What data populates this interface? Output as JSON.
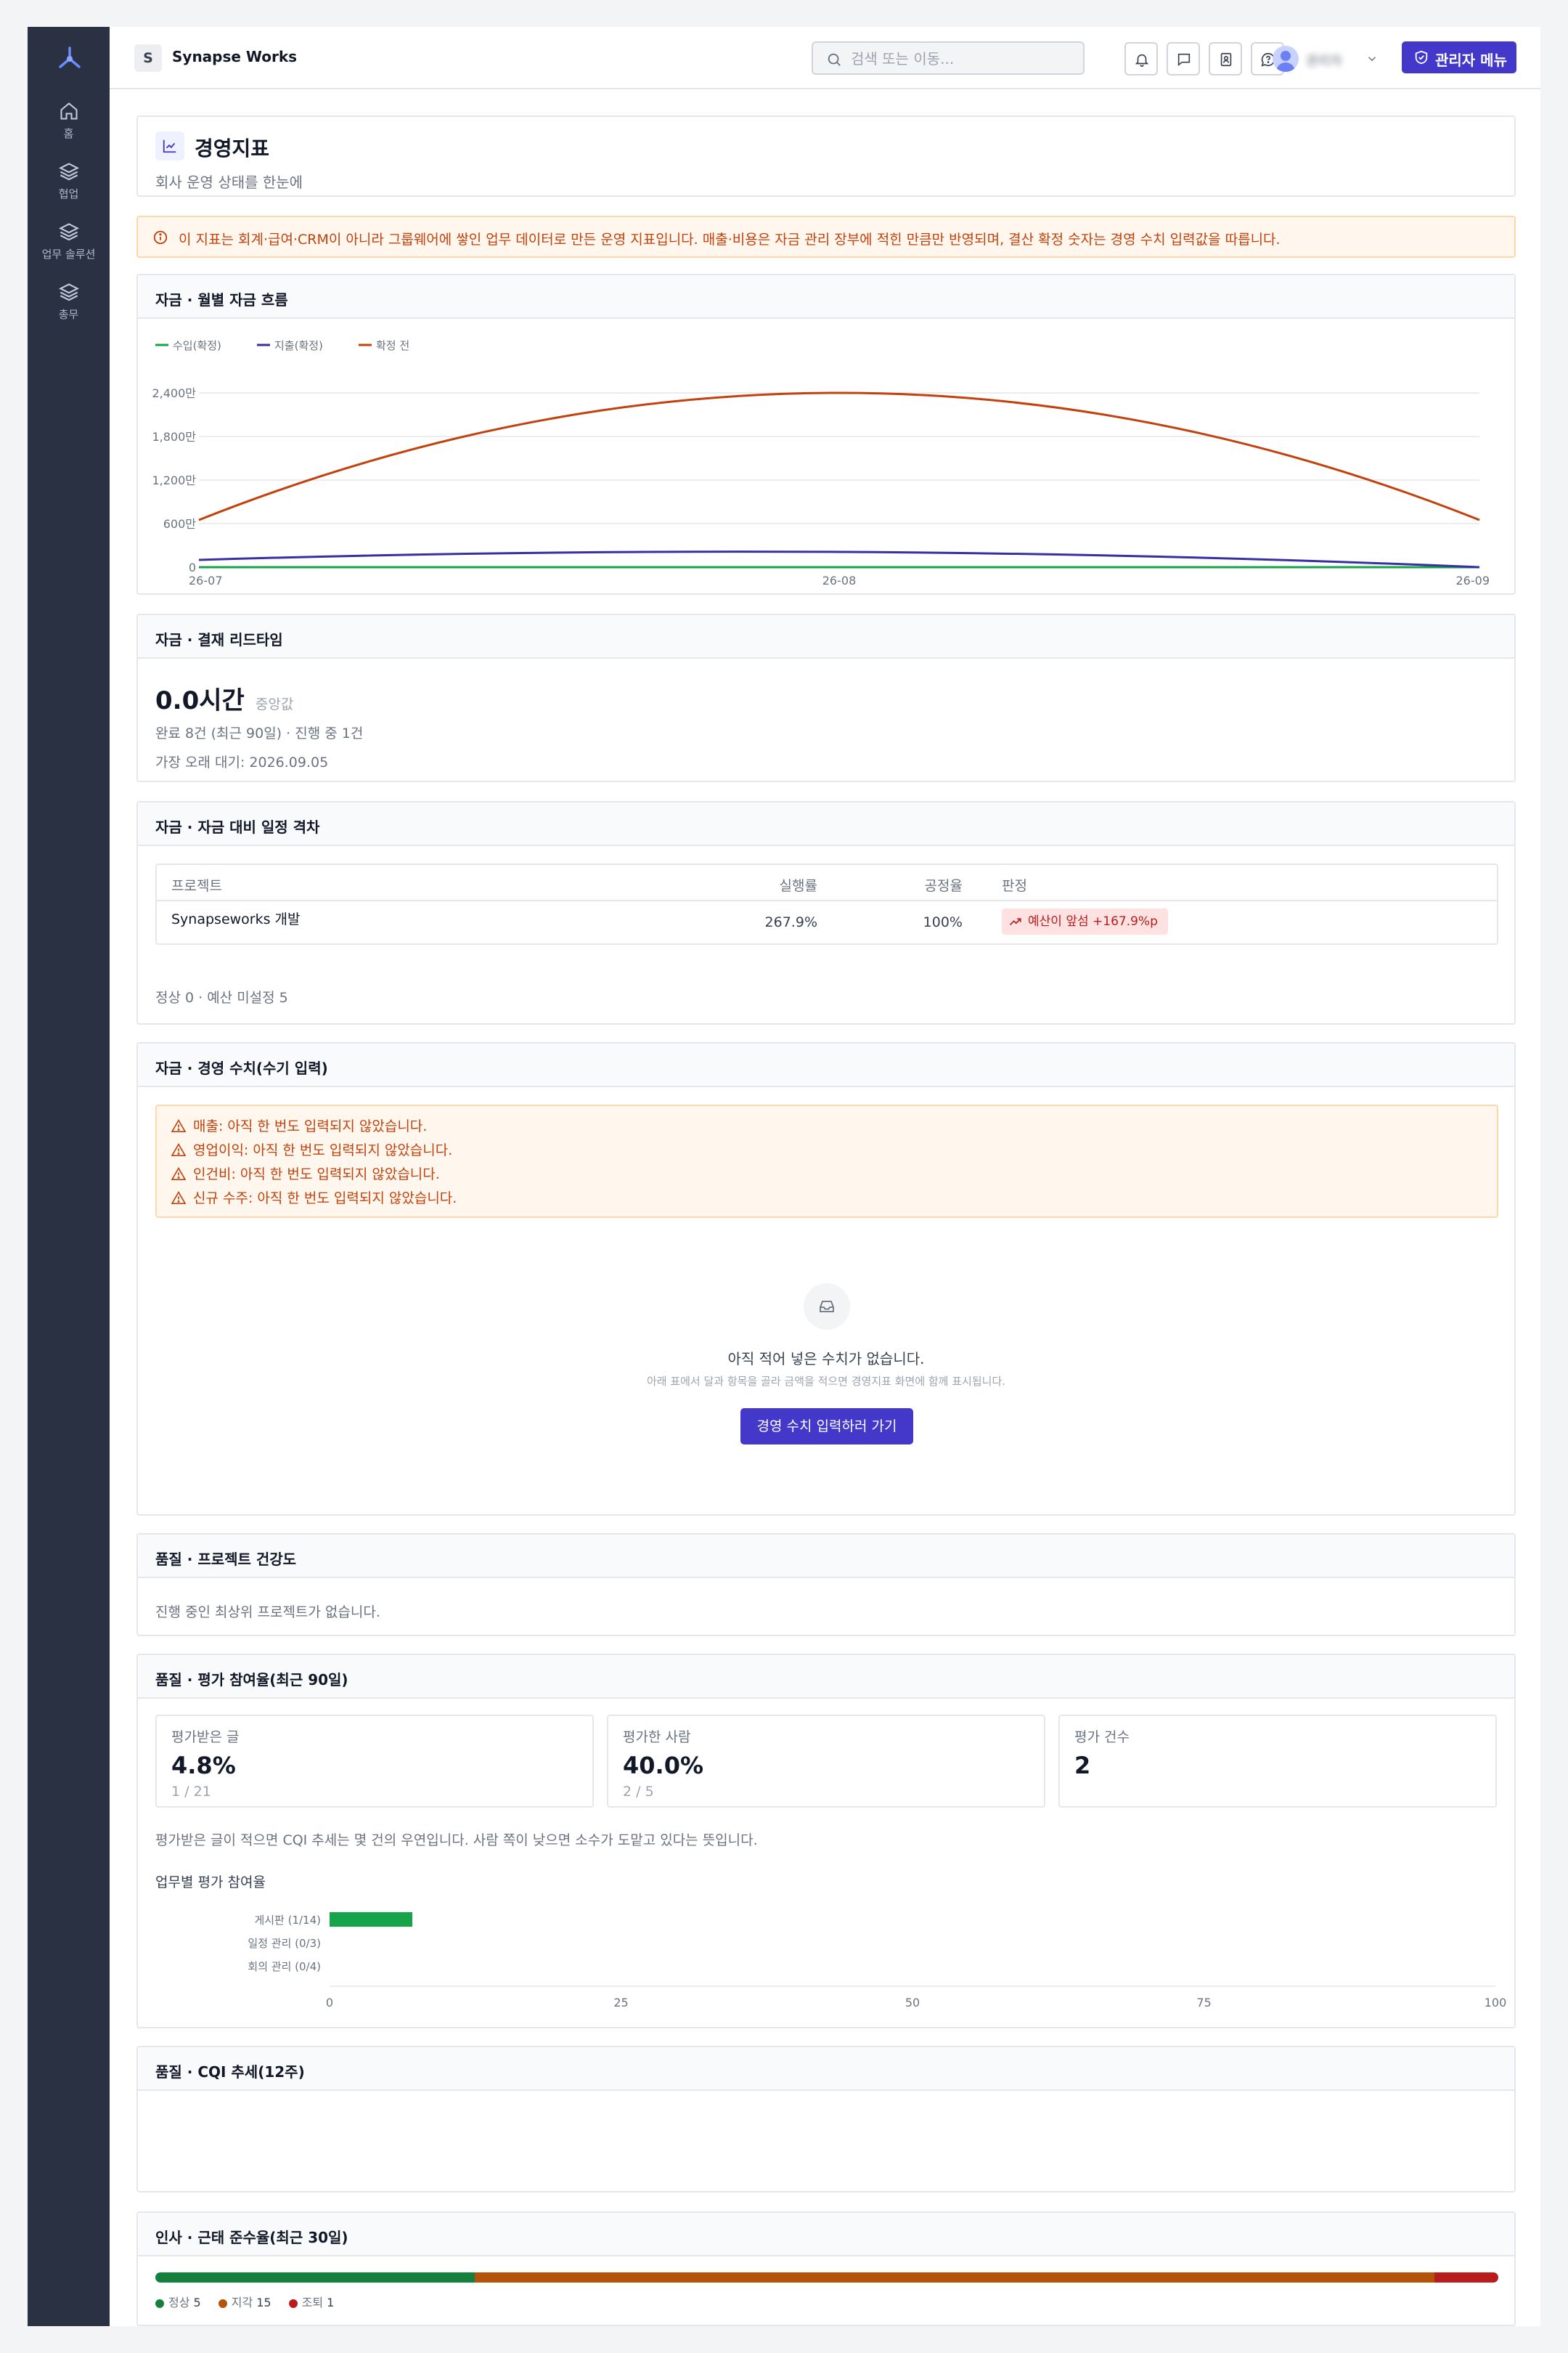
{
  "app": {
    "workspace_badge": "S",
    "workspace_name": "Synapse Works"
  },
  "sidebar": {
    "items": [
      {
        "label": "홈",
        "icon": "home-icon"
      },
      {
        "label": "협업",
        "icon": "layers-icon"
      },
      {
        "label": "업무 솔루션",
        "icon": "layers-icon"
      },
      {
        "label": "총무",
        "icon": "layers-icon"
      }
    ]
  },
  "topbar": {
    "search_placeholder": "검색 또는 이동...",
    "user_name": "관리자",
    "admin_button": "관리자 메뉴"
  },
  "page": {
    "title": "경영지표",
    "subtitle": "회사 운영 상태를 한눈에"
  },
  "notice": "이 지표는 회계·급여·CRM이 아니라 그룹웨어에 쌓인 업무 데이터로 만든 운영 지표입니다. 매출·비용은 자금 관리 장부에 적힌 만큼만 반영되며, 결산 확정 숫자는 경영 수치 입력값을 따릅니다.",
  "cashflow": {
    "title": "자금 · 월별 자금 흐름",
    "colors": {
      "income": "#16a34a",
      "expense": "#3730a3",
      "pending": "#c2410c"
    }
  },
  "chart_data": {
    "type": "line",
    "x": [
      "26-07",
      "26-08",
      "26-09"
    ],
    "series": [
      {
        "name": "수입(확정)",
        "values": [
          0,
          0,
          0
        ]
      },
      {
        "name": "지출(확정)",
        "values": [
          100,
          210,
          0
        ]
      },
      {
        "name": "확정 전",
        "values": [
          650,
          2400,
          650
        ]
      }
    ],
    "yticks": [
      "0",
      "600만",
      "1,200만",
      "1,800만",
      "2,400만"
    ],
    "ylim": [
      0,
      2400
    ],
    "grid": true,
    "legend": "top-left"
  },
  "leadtime": {
    "title": "자금 · 결재 리드타임",
    "value": "0.0시간",
    "value_note": "중앙값",
    "line1": "완료 8건 (최근 90일) · 진행 중 1건",
    "line2": "가장 오래 대기: 2026.09.05"
  },
  "gap": {
    "title": "자금 · 자금 대비 일정 격차",
    "headers": {
      "project": "프로젝트",
      "exec": "실행률",
      "progress": "공정율",
      "verdict": "판정"
    },
    "row": {
      "project": "Synapseworks 개발",
      "exec": "267.9%",
      "progress": "100%",
      "verdict": "예산이 앞섬 +167.9%p"
    },
    "footer": "정상 0 · 예산 미설정 5"
  },
  "manual": {
    "title": "자금 · 경영 수치(수기 입력)",
    "warnings": [
      "매출: 아직 한 번도 입력되지 않았습니다.",
      "영업이익: 아직 한 번도 입력되지 않았습니다.",
      "인건비: 아직 한 번도 입력되지 않았습니다.",
      "신규 수주: 아직 한 번도 입력되지 않았습니다."
    ],
    "empty_title": "아직 적어 넣은 수치가 없습니다.",
    "empty_desc": "아래 표에서 달과 항목을 골라 금액을 적으면 경영지표 화면에 함께 표시됩니다.",
    "cta": "경영 수치 입력하러 가기"
  },
  "health": {
    "title": "품질 · 프로젝트 건강도",
    "empty": "진행 중인 최상위 프로젝트가 없습니다."
  },
  "participation": {
    "title": "품질 · 평가 참여율(최근 90일)",
    "metrics": [
      {
        "label": "평가받은 글",
        "value": "4.8%",
        "sub": "1 / 21"
      },
      {
        "label": "평가한 사람",
        "value": "40.0%",
        "sub": "2 / 5"
      },
      {
        "label": "평가 건수",
        "value": "2",
        "sub": ""
      }
    ],
    "note": "평가받은 글이 적으면 CQI 추세는 몇 건의 우연입니다. 사람 쪽이 낮으면 소수가 도맡고 있다는 뜻입니다.",
    "chart_title": "업무별 평가 참여율",
    "bars": [
      {
        "label": "게시판 (1/14)",
        "value": 7.1
      },
      {
        "label": "일정 관리 (0/3)",
        "value": 0
      },
      {
        "label": "회의 관리 (0/4)",
        "value": 0
      }
    ],
    "ticks": [
      "0",
      "25",
      "50",
      "75",
      "100"
    ],
    "bar_color": "#16a34a"
  },
  "cqi": {
    "title": "품질 · CQI 추세(12주)"
  },
  "attendance": {
    "title": "인사 · 근태 준수율(최근 30일)",
    "segments": [
      {
        "label": "정상",
        "count": "5",
        "value": 5,
        "color": "#15803d"
      },
      {
        "label": "지각",
        "count": "15",
        "value": 15,
        "color": "#b45309"
      },
      {
        "label": "조퇴",
        "count": "1",
        "value": 1,
        "color": "#b91c1c"
      }
    ]
  }
}
